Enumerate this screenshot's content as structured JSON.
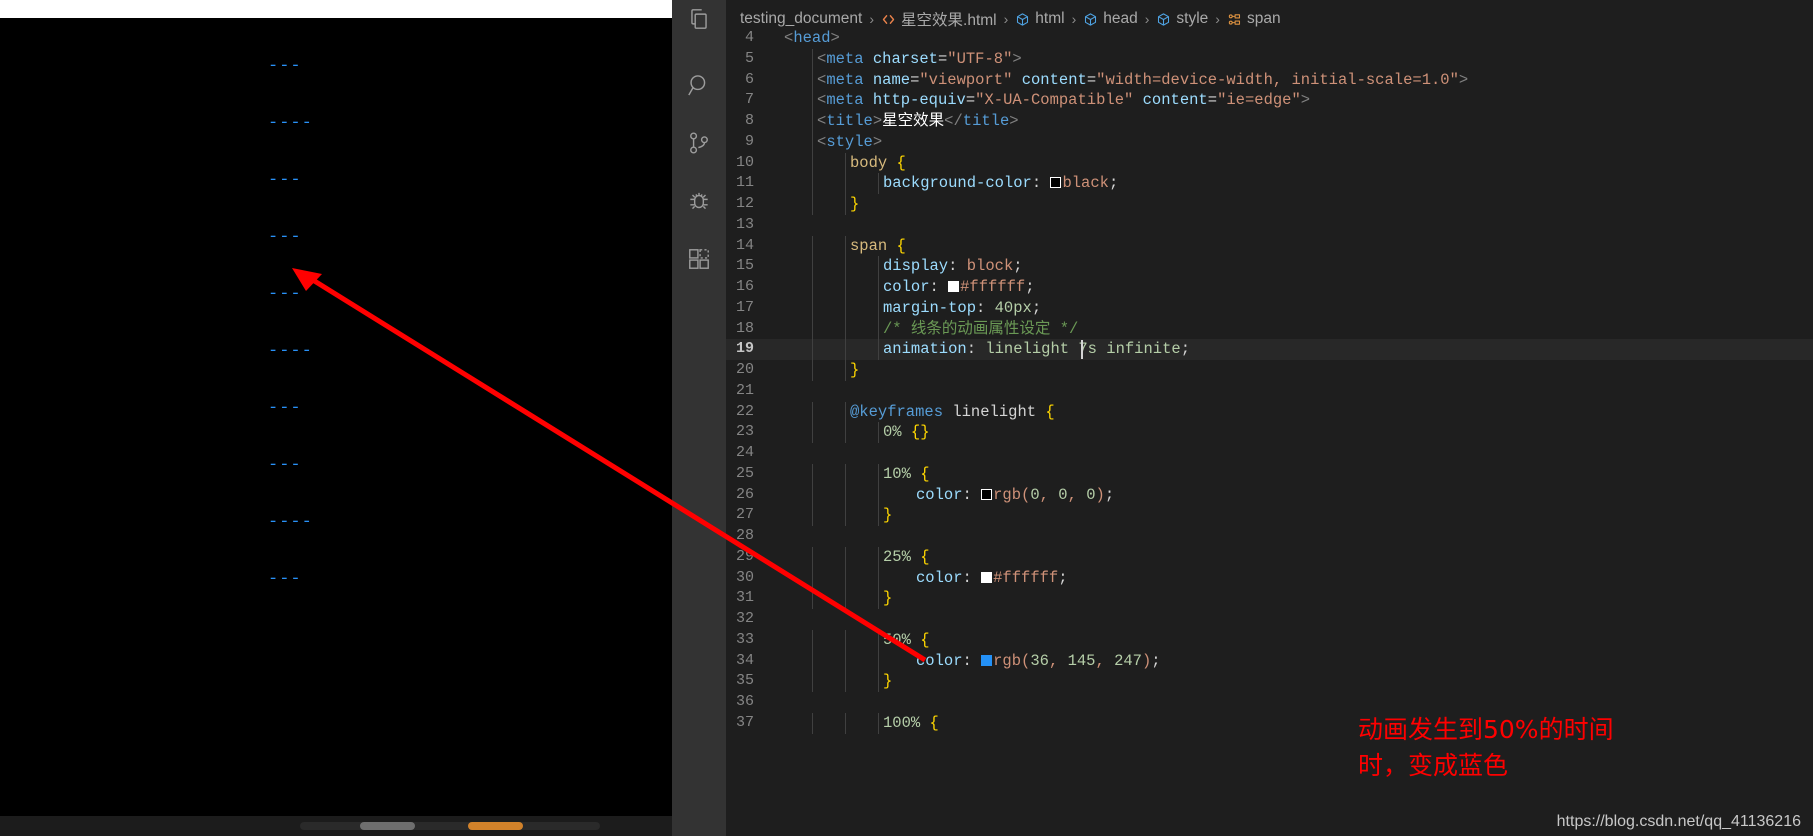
{
  "preview": {
    "background_color": "#000000",
    "line_color": "#2991f7",
    "lines": [
      "---",
      "----",
      "---",
      "---",
      "---",
      "----",
      "---",
      "---",
      "----",
      "---"
    ]
  },
  "activity_bar": {
    "items": [
      {
        "name": "explorer-icon",
        "label": "Explorer"
      },
      {
        "name": "search-icon",
        "label": "Search"
      },
      {
        "name": "source-control-icon",
        "label": "Source Control"
      },
      {
        "name": "run-debug-icon",
        "label": "Run and Debug"
      },
      {
        "name": "extensions-icon",
        "label": "Extensions"
      }
    ]
  },
  "breadcrumb": {
    "items": [
      {
        "label": "testing_document",
        "icon": ""
      },
      {
        "label": "星空效果.html",
        "icon": "html-file-icon"
      },
      {
        "label": "html",
        "icon": "symbol-element-icon"
      },
      {
        "label": "head",
        "icon": "symbol-element-icon"
      },
      {
        "label": "style",
        "icon": "symbol-element-icon"
      },
      {
        "label": "span",
        "icon": "symbol-field-icon"
      }
    ],
    "separator": "›"
  },
  "editor": {
    "active_line": 19,
    "cursor_after": "animation: linelight 7",
    "lines": [
      {
        "n": "4",
        "indent": 0,
        "tokens": [
          {
            "c": "t-brk",
            "t": "<"
          },
          {
            "c": "t-tag",
            "t": "head"
          },
          {
            "c": "t-brk",
            "t": ">"
          }
        ]
      },
      {
        "n": "5",
        "indent": 1,
        "tokens": [
          {
            "c": "t-brk",
            "t": "<"
          },
          {
            "c": "t-tag",
            "t": "meta"
          },
          {
            "c": "t-plain",
            "t": " "
          },
          {
            "c": "t-attr",
            "t": "charset"
          },
          {
            "c": "t-plain",
            "t": "="
          },
          {
            "c": "t-str",
            "t": "\"UTF-8\""
          },
          {
            "c": "t-brk",
            "t": ">"
          }
        ]
      },
      {
        "n": "6",
        "indent": 1,
        "tokens": [
          {
            "c": "t-brk",
            "t": "<"
          },
          {
            "c": "t-tag",
            "t": "meta"
          },
          {
            "c": "t-plain",
            "t": " "
          },
          {
            "c": "t-attr",
            "t": "name"
          },
          {
            "c": "t-plain",
            "t": "="
          },
          {
            "c": "t-str",
            "t": "\"viewport\""
          },
          {
            "c": "t-plain",
            "t": " "
          },
          {
            "c": "t-attr",
            "t": "content"
          },
          {
            "c": "t-plain",
            "t": "="
          },
          {
            "c": "t-str",
            "t": "\"width=device-width, initial-scale=1.0\""
          },
          {
            "c": "t-brk",
            "t": ">"
          }
        ]
      },
      {
        "n": "7",
        "indent": 1,
        "tokens": [
          {
            "c": "t-brk",
            "t": "<"
          },
          {
            "c": "t-tag",
            "t": "meta"
          },
          {
            "c": "t-plain",
            "t": " "
          },
          {
            "c": "t-attr",
            "t": "http-equiv"
          },
          {
            "c": "t-plain",
            "t": "="
          },
          {
            "c": "t-str",
            "t": "\"X-UA-Compatible\""
          },
          {
            "c": "t-plain",
            "t": " "
          },
          {
            "c": "t-attr",
            "t": "content"
          },
          {
            "c": "t-plain",
            "t": "="
          },
          {
            "c": "t-str",
            "t": "\"ie=edge\""
          },
          {
            "c": "t-brk",
            "t": ">"
          }
        ]
      },
      {
        "n": "8",
        "indent": 1,
        "tokens": [
          {
            "c": "t-brk",
            "t": "<"
          },
          {
            "c": "t-tag",
            "t": "title"
          },
          {
            "c": "t-brk",
            "t": ">"
          },
          {
            "c": "t-cjk",
            "t": "星空效果"
          },
          {
            "c": "t-brk",
            "t": "</"
          },
          {
            "c": "t-tag",
            "t": "title"
          },
          {
            "c": "t-brk",
            "t": ">"
          }
        ]
      },
      {
        "n": "9",
        "indent": 1,
        "tokens": [
          {
            "c": "t-brk",
            "t": "<"
          },
          {
            "c": "t-tag",
            "t": "style"
          },
          {
            "c": "t-brk",
            "t": ">"
          }
        ]
      },
      {
        "n": "10",
        "indent": 2,
        "tokens": [
          {
            "c": "t-sel",
            "t": "body"
          },
          {
            "c": "t-plain",
            "t": " "
          },
          {
            "c": "t-brace",
            "t": "{"
          }
        ]
      },
      {
        "n": "11",
        "indent": 3,
        "tokens": [
          {
            "c": "t-prop",
            "t": "background-color"
          },
          {
            "c": "t-plain",
            "t": ": "
          },
          {
            "c": "swatch sw-black",
            "t": ""
          },
          {
            "c": "t-val",
            "t": "black"
          },
          {
            "c": "t-plain",
            "t": ";"
          }
        ]
      },
      {
        "n": "12",
        "indent": 2,
        "tokens": [
          {
            "c": "t-brace",
            "t": "}"
          }
        ]
      },
      {
        "n": "13",
        "indent": 0,
        "tokens": []
      },
      {
        "n": "14",
        "indent": 2,
        "tokens": [
          {
            "c": "t-sel",
            "t": "span"
          },
          {
            "c": "t-plain",
            "t": " "
          },
          {
            "c": "t-brace",
            "t": "{"
          }
        ]
      },
      {
        "n": "15",
        "indent": 3,
        "tokens": [
          {
            "c": "t-prop",
            "t": "display"
          },
          {
            "c": "t-plain",
            "t": ": "
          },
          {
            "c": "t-val",
            "t": "block"
          },
          {
            "c": "t-plain",
            "t": ";"
          }
        ]
      },
      {
        "n": "16",
        "indent": 3,
        "tokens": [
          {
            "c": "t-prop",
            "t": "color"
          },
          {
            "c": "t-plain",
            "t": ": "
          },
          {
            "c": "swatch sw-white",
            "t": ""
          },
          {
            "c": "t-val",
            "t": "#ffffff"
          },
          {
            "c": "t-plain",
            "t": ";"
          }
        ]
      },
      {
        "n": "17",
        "indent": 3,
        "tokens": [
          {
            "c": "t-prop",
            "t": "margin-top"
          },
          {
            "c": "t-plain",
            "t": ": "
          },
          {
            "c": "t-num",
            "t": "40px"
          },
          {
            "c": "t-plain",
            "t": ";"
          }
        ]
      },
      {
        "n": "18",
        "indent": 3,
        "tokens": [
          {
            "c": "t-cmt",
            "t": "/* 线条的动画属性设定 */"
          }
        ]
      },
      {
        "n": "19",
        "indent": 3,
        "active": true,
        "tokens": [
          {
            "c": "t-prop",
            "t": "animation"
          },
          {
            "c": "t-plain",
            "t": ": "
          },
          {
            "c": "t-num",
            "t": "linelight 7s"
          },
          {
            "c": "t-plain",
            "t": " "
          },
          {
            "c": "t-num",
            "t": "infinite"
          },
          {
            "c": "t-plain",
            "t": ";"
          }
        ]
      },
      {
        "n": "20",
        "indent": 2,
        "tokens": [
          {
            "c": "t-brace",
            "t": "}"
          }
        ]
      },
      {
        "n": "21",
        "indent": 0,
        "tokens": []
      },
      {
        "n": "22",
        "indent": 2,
        "tokens": [
          {
            "c": "t-at",
            "t": "@keyframes"
          },
          {
            "c": "t-plain",
            "t": " "
          },
          {
            "c": "t-plain",
            "t": "linelight"
          },
          {
            "c": "t-plain",
            "t": " "
          },
          {
            "c": "t-brace",
            "t": "{"
          }
        ]
      },
      {
        "n": "23",
        "indent": 3,
        "tokens": [
          {
            "c": "t-num",
            "t": "0%"
          },
          {
            "c": "t-plain",
            "t": " "
          },
          {
            "c": "t-brace",
            "t": "{}"
          }
        ]
      },
      {
        "n": "24",
        "indent": 0,
        "tokens": []
      },
      {
        "n": "25",
        "indent": 3,
        "tokens": [
          {
            "c": "t-num",
            "t": "10%"
          },
          {
            "c": "t-plain",
            "t": " "
          },
          {
            "c": "t-brace",
            "t": "{"
          }
        ]
      },
      {
        "n": "26",
        "indent": 4,
        "tokens": [
          {
            "c": "t-prop",
            "t": "color"
          },
          {
            "c": "t-plain",
            "t": ": "
          },
          {
            "c": "swatch sw-black",
            "t": ""
          },
          {
            "c": "t-val",
            "t": "rgb("
          },
          {
            "c": "t-num",
            "t": "0"
          },
          {
            "c": "t-val",
            "t": ", "
          },
          {
            "c": "t-num",
            "t": "0"
          },
          {
            "c": "t-val",
            "t": ", "
          },
          {
            "c": "t-num",
            "t": "0"
          },
          {
            "c": "t-val",
            "t": ")"
          },
          {
            "c": "t-plain",
            "t": ";"
          }
        ]
      },
      {
        "n": "27",
        "indent": 3,
        "tokens": [
          {
            "c": "t-brace",
            "t": "}"
          }
        ]
      },
      {
        "n": "28",
        "indent": 0,
        "tokens": []
      },
      {
        "n": "29",
        "indent": 3,
        "tokens": [
          {
            "c": "t-num",
            "t": "25%"
          },
          {
            "c": "t-plain",
            "t": " "
          },
          {
            "c": "t-brace",
            "t": "{"
          }
        ]
      },
      {
        "n": "30",
        "indent": 4,
        "tokens": [
          {
            "c": "t-prop",
            "t": "color"
          },
          {
            "c": "t-plain",
            "t": ": "
          },
          {
            "c": "swatch sw-white",
            "t": ""
          },
          {
            "c": "t-val",
            "t": "#ffffff"
          },
          {
            "c": "t-plain",
            "t": ";"
          }
        ]
      },
      {
        "n": "31",
        "indent": 3,
        "tokens": [
          {
            "c": "t-brace",
            "t": "}"
          }
        ]
      },
      {
        "n": "32",
        "indent": 0,
        "tokens": []
      },
      {
        "n": "33",
        "indent": 3,
        "tokens": [
          {
            "c": "t-num",
            "t": "50%"
          },
          {
            "c": "t-plain",
            "t": " "
          },
          {
            "c": "t-brace",
            "t": "{"
          }
        ]
      },
      {
        "n": "34",
        "indent": 4,
        "tokens": [
          {
            "c": "t-prop",
            "t": "color"
          },
          {
            "c": "t-plain",
            "t": ": "
          },
          {
            "c": "swatch sw-blue",
            "t": ""
          },
          {
            "c": "t-val",
            "t": "rgb("
          },
          {
            "c": "t-num",
            "t": "36"
          },
          {
            "c": "t-val",
            "t": ", "
          },
          {
            "c": "t-num",
            "t": "145"
          },
          {
            "c": "t-val",
            "t": ", "
          },
          {
            "c": "t-num",
            "t": "247"
          },
          {
            "c": "t-val",
            "t": ")"
          },
          {
            "c": "t-plain",
            "t": ";"
          }
        ]
      },
      {
        "n": "35",
        "indent": 3,
        "tokens": [
          {
            "c": "t-brace",
            "t": "}"
          }
        ]
      },
      {
        "n": "36",
        "indent": 0,
        "tokens": []
      },
      {
        "n": "37",
        "indent": 3,
        "tokens": [
          {
            "c": "t-num",
            "t": "100%"
          },
          {
            "c": "t-plain",
            "t": " "
          },
          {
            "c": "t-brace",
            "t": "{"
          }
        ]
      }
    ]
  },
  "annotation": {
    "text": "动画发生到50%的时间时，变成蓝色",
    "color": "#ff0000",
    "arrow_color": "#ff0000"
  },
  "watermark": {
    "text": "https://blog.csdn.net/qq_41136216"
  }
}
